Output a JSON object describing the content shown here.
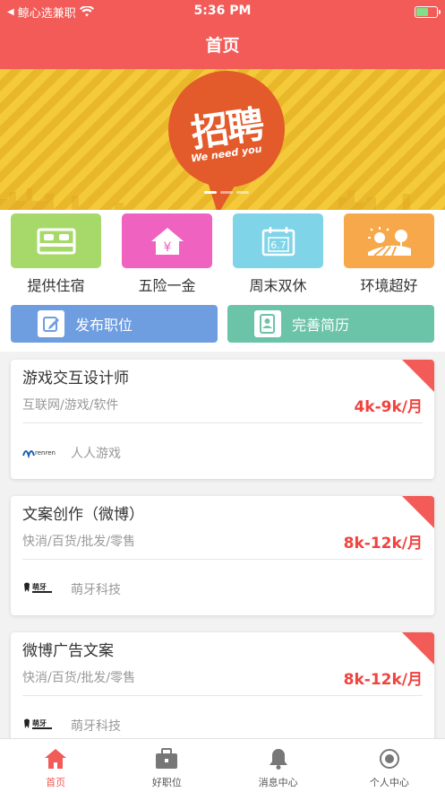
{
  "status": {
    "carrier": "鲸心选兼职",
    "time": "5:36 PM"
  },
  "header": {
    "title": "首页"
  },
  "banner": {
    "headline": "招聘",
    "tagline": "We need you"
  },
  "features": [
    {
      "label": "提供住宿",
      "icon": "bed-icon",
      "color": "#a6d96a"
    },
    {
      "label": "五险一金",
      "icon": "house-yen-icon",
      "color": "#f062c0"
    },
    {
      "label": "周末双休",
      "icon": "calendar-icon",
      "color": "#7fd4e8"
    },
    {
      "label": "环境超好",
      "icon": "landscape-icon",
      "color": "#f7a84a"
    }
  ],
  "actions": {
    "post_job": {
      "label": "发布职位",
      "color": "#6e9de0"
    },
    "complete_resume": {
      "label": "完善简历",
      "color": "#6cc4a8"
    }
  },
  "jobs": [
    {
      "title": "游戏交互设计师",
      "category": "互联网/游戏/软件",
      "salary": "4k-9k/月",
      "company": "人人游戏",
      "logo_text": "renren"
    },
    {
      "title": "文案创作（微博）",
      "category": "快消/百货/批发/零售",
      "salary": "8k-12k/月",
      "company": "萌牙科技",
      "logo_text": "萌牙"
    },
    {
      "title": "微博广告文案",
      "category": "快消/百货/批发/零售",
      "salary": "8k-12k/月",
      "company": "萌牙科技",
      "logo_text": "萌牙"
    }
  ],
  "tabs": [
    {
      "label": "首页",
      "icon": "home-icon",
      "active": true
    },
    {
      "label": "好职位",
      "icon": "briefcase-icon",
      "active": false
    },
    {
      "label": "消息中心",
      "icon": "bell-icon",
      "active": false
    },
    {
      "label": "个人中心",
      "icon": "user-icon",
      "active": false
    }
  ],
  "colors": {
    "brand": "#f25b57",
    "salary": "#f0433f"
  }
}
